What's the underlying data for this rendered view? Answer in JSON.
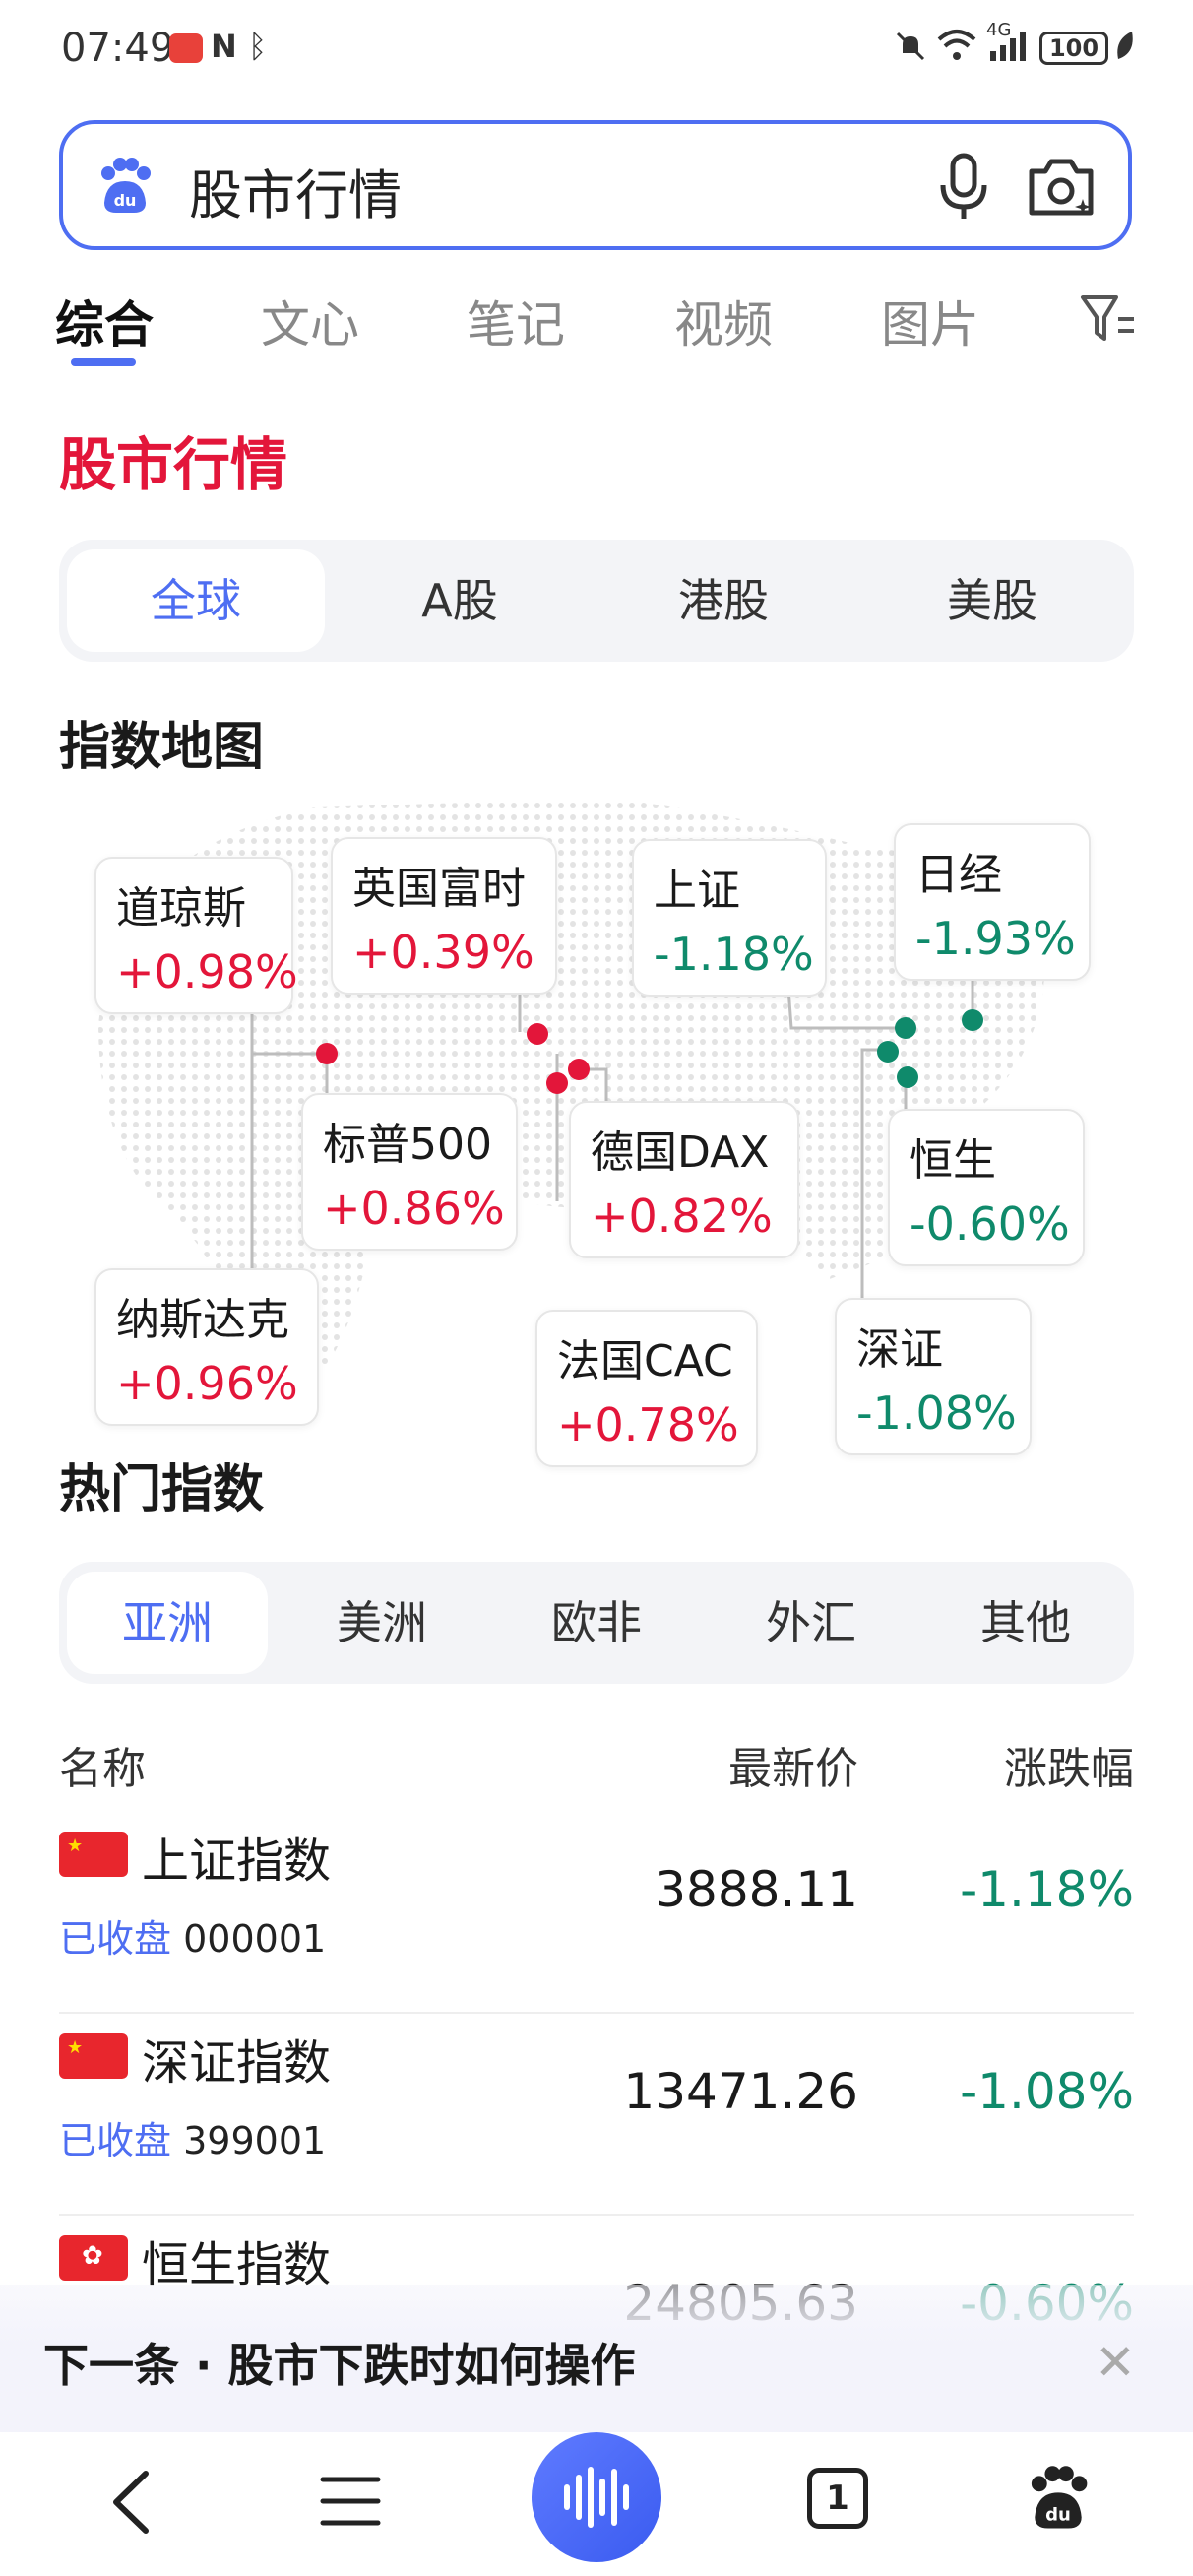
{
  "status_bar": {
    "time": "07:49",
    "nfc": "N",
    "bluetooth": "ᛒ",
    "signal": "4G",
    "battery": "100"
  },
  "search": {
    "query": "股市行情"
  },
  "tabs": [
    {
      "label": "综合",
      "active": true
    },
    {
      "label": "文心",
      "active": false
    },
    {
      "label": "笔记",
      "active": false
    },
    {
      "label": "视频",
      "active": false
    },
    {
      "label": "图片",
      "active": false
    }
  ],
  "section_title": "股市行情",
  "market_tabs": [
    "全球",
    "A股",
    "港股",
    "美股"
  ],
  "map_title": "指数地图",
  "map_cards": [
    {
      "name": "道琼斯",
      "change": "+0.98%",
      "dir": "up"
    },
    {
      "name": "英国富时",
      "change": "+0.39%",
      "dir": "up"
    },
    {
      "name": "上证",
      "change": "-1.18%",
      "dir": "down"
    },
    {
      "name": "日经",
      "change": "-1.93%",
      "dir": "down"
    },
    {
      "name": "标普500",
      "change": "+0.86%",
      "dir": "up"
    },
    {
      "name": "德国DAX",
      "change": "+0.82%",
      "dir": "up"
    },
    {
      "name": "恒生",
      "change": "-0.60%",
      "dir": "down"
    },
    {
      "name": "纳斯达克",
      "change": "+0.96%",
      "dir": "up"
    },
    {
      "name": "法国CAC",
      "change": "+0.78%",
      "dir": "up"
    },
    {
      "name": "深证",
      "change": "-1.08%",
      "dir": "down"
    }
  ],
  "hot_title": "热门指数",
  "region_tabs": [
    "亚洲",
    "美洲",
    "欧非",
    "外汇",
    "其他"
  ],
  "table": {
    "headers": {
      "name": "名称",
      "price": "最新价",
      "change": "涨跌幅"
    },
    "rows": [
      {
        "name": "上证指数",
        "status": "已收盘",
        "code": "000001",
        "price": "3888.11",
        "change": "-1.18%"
      },
      {
        "name": "深证指数",
        "status": "已收盘",
        "code": "399001",
        "price": "13471.26",
        "change": "-1.08%"
      },
      {
        "name": "恒生指数",
        "status": "",
        "code": "",
        "price": "24805.63",
        "change": "-0.60%"
      }
    ]
  },
  "next_banner": "下一条 · 股市下跌时如何操作",
  "nav": {
    "tab_count": "1"
  },
  "colors": {
    "accent": "#4e6ef2",
    "up": "#e3163a",
    "down": "#0f8a6b"
  }
}
